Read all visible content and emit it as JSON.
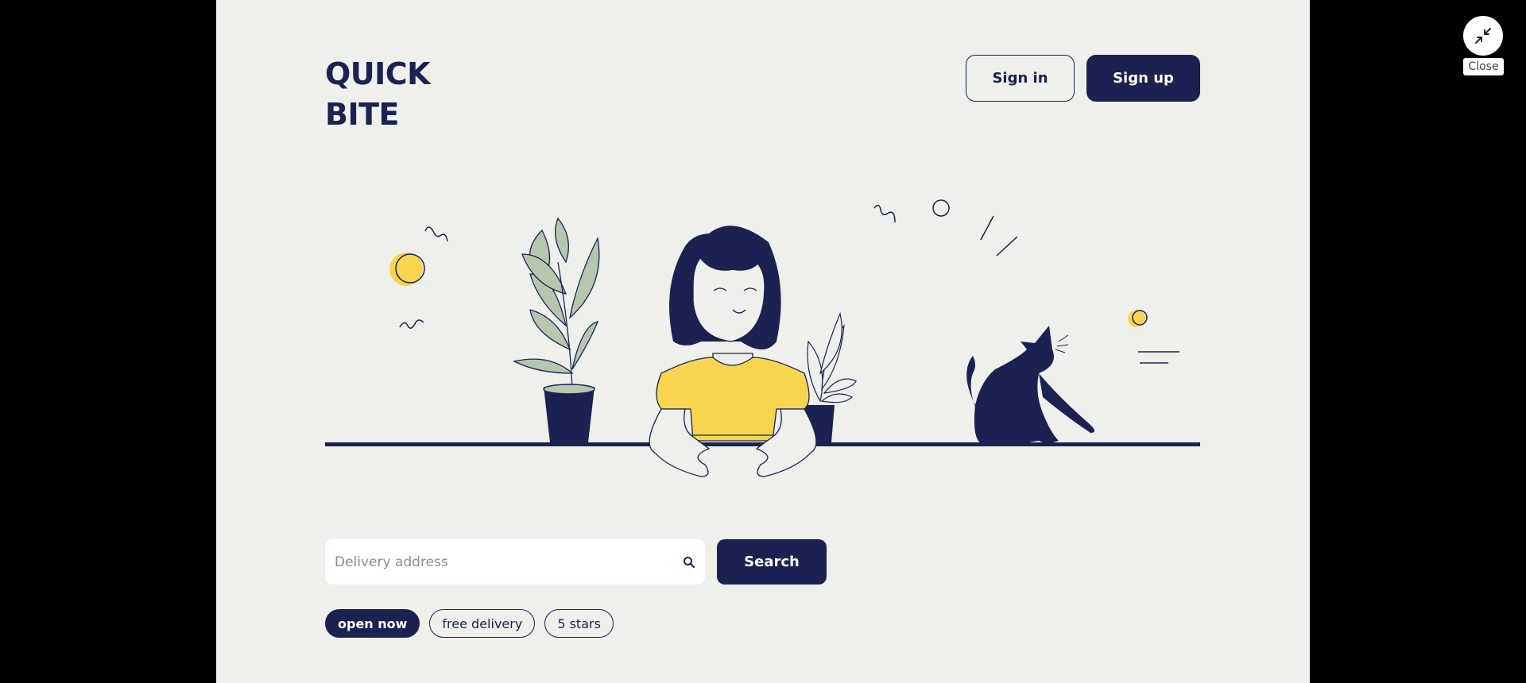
{
  "brand": {
    "line1": "QUICK",
    "line2": "BITE"
  },
  "header": {
    "signin_label": "Sign in",
    "signup_label": "Sign up"
  },
  "search": {
    "placeholder": "Delivery address",
    "value": "",
    "button_label": "Search",
    "icon": "search-icon"
  },
  "filters": [
    {
      "label": "open now",
      "active": true
    },
    {
      "label": "free delivery",
      "active": false
    },
    {
      "label": "5 stars",
      "active": false
    }
  ],
  "overlay": {
    "close_label": "Close",
    "close_icon": "minimize-arrows-icon"
  },
  "colors": {
    "navy": "#1b2150",
    "background": "#eef0ec",
    "accent_yellow": "#f7d54f",
    "leaf_green": "#b7c7ae"
  },
  "illustration": {
    "name": "woman-plants-cat-illustration"
  }
}
